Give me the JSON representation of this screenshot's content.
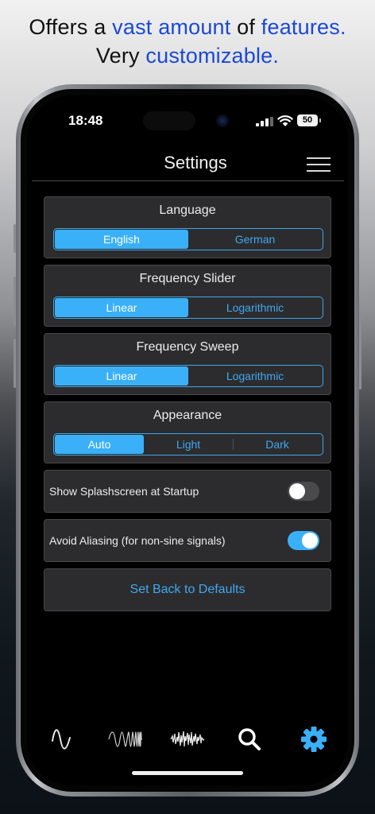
{
  "headline": {
    "line1_a": "Offers a ",
    "line1_b": "vast amount",
    "line1_c": " of ",
    "line1_d": "features.",
    "line2_a": "Very ",
    "line2_b": "customizable."
  },
  "status_bar": {
    "time": "18:48",
    "battery": "50"
  },
  "nav": {
    "title": "Settings",
    "menu_icon": "hamburger-menu-icon"
  },
  "settings": {
    "language": {
      "title": "Language",
      "options": [
        "English",
        "German"
      ],
      "selected": "English"
    },
    "frequency_slider": {
      "title": "Frequency Slider",
      "options": [
        "Linear",
        "Logarithmic"
      ],
      "selected": "Linear"
    },
    "frequency_sweep": {
      "title": "Frequency Sweep",
      "options": [
        "Linear",
        "Logarithmic"
      ],
      "selected": "Linear"
    },
    "appearance": {
      "title": "Appearance",
      "options": [
        "Auto",
        "Light",
        "Dark"
      ],
      "selected": "Auto"
    },
    "splashscreen": {
      "label": "Show Splashscreen at Startup",
      "enabled": false
    },
    "aliasing": {
      "label": "Avoid Aliasing (for non-sine signals)",
      "enabled": true
    },
    "reset": {
      "label": "Set Back to Defaults"
    }
  },
  "tabs": [
    {
      "icon": "sine-wave-icon",
      "active": false
    },
    {
      "icon": "frequency-sweep-icon",
      "active": false
    },
    {
      "icon": "noise-waveform-icon",
      "active": false
    },
    {
      "icon": "search-icon",
      "active": false
    },
    {
      "icon": "gear-icon",
      "active": true
    }
  ],
  "colors": {
    "accent": "#3ab0f8",
    "headline_highlight": "#1a49d6",
    "card_background": "#2c2c2e"
  }
}
